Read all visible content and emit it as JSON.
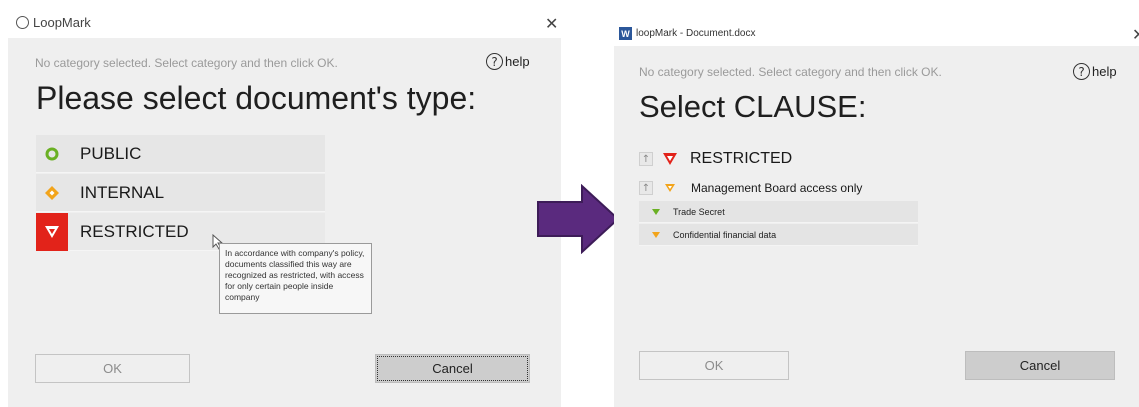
{
  "left_dialog": {
    "title": "LoopMark",
    "hint": "No category selected. Select category and then click OK.",
    "help_label": "help",
    "heading": "Please select document's type:",
    "options": [
      {
        "label": "PUBLIC",
        "color": "#6ab023",
        "icon": "circle-icon"
      },
      {
        "label": "INTERNAL",
        "color": "#f2a41b",
        "icon": "diamond-icon"
      },
      {
        "label": "RESTRICTED",
        "color": "#e2231a",
        "icon": "triangle-down-icon"
      }
    ],
    "tooltip": "In accordance with company's policy, documents classified this way are recognized as restricted, with access for only certain people inside company",
    "ok_label": "OK",
    "cancel_label": "Cancel"
  },
  "arrow": {
    "color": "#5a2a7e"
  },
  "right_dialog": {
    "title": "loopMark - Document.docx",
    "hint": "No category selected. Select category and then click OK.",
    "help_label": "help",
    "heading": "Select CLAUSE:",
    "path": [
      {
        "label": "RESTRICTED",
        "color": "#e2231a"
      },
      {
        "label": "Management Board access only",
        "color": "#f2a41b"
      }
    ],
    "clauses": [
      {
        "label": "Trade Secret",
        "color": "#6ab023"
      },
      {
        "label": "Confidential financial data",
        "color": "#f2a41b"
      }
    ],
    "ok_label": "OK",
    "cancel_label": "Cancel"
  }
}
